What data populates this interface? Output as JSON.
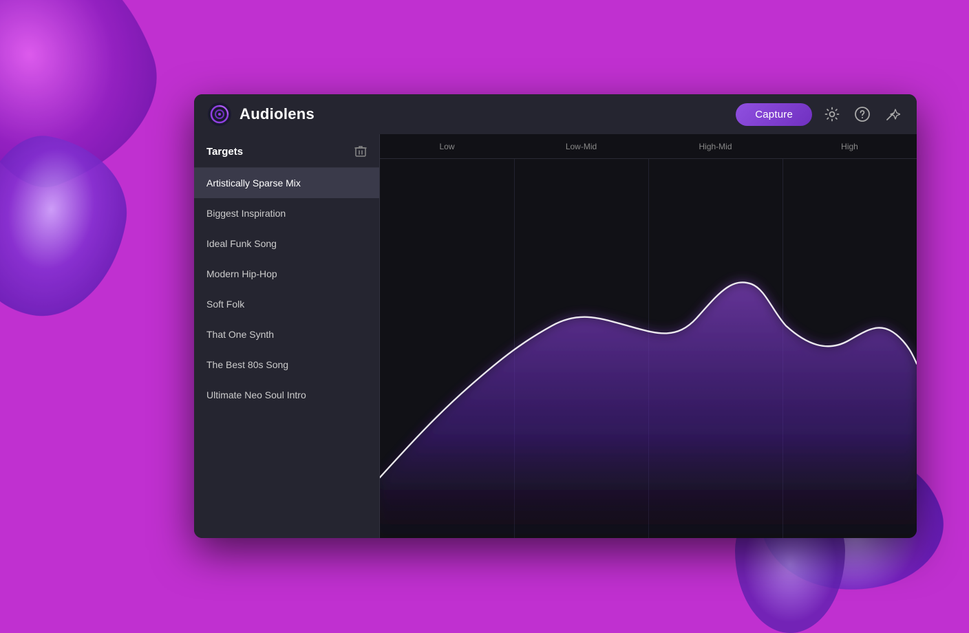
{
  "app": {
    "title": "Audiolens",
    "capture_label": "Capture"
  },
  "header": {
    "settings_icon": "⚙",
    "help_icon": "?",
    "wand_icon": "✦"
  },
  "sidebar": {
    "title": "Targets",
    "trash_icon": "🗑",
    "items": [
      {
        "label": "Artistically Sparse Mix",
        "active": true
      },
      {
        "label": "Biggest Inspiration",
        "active": false
      },
      {
        "label": "Ideal Funk Song",
        "active": false
      },
      {
        "label": "Modern Hip-Hop",
        "active": false
      },
      {
        "label": "Soft Folk",
        "active": false
      },
      {
        "label": "That One Synth",
        "active": false
      },
      {
        "label": "The Best 80s Song",
        "active": false
      },
      {
        "label": "Ultimate Neo Soul Intro",
        "active": false
      }
    ]
  },
  "spectrum": {
    "freq_labels": [
      "Low",
      "Low-Mid",
      "High-Mid",
      "High"
    ],
    "accent_color": "#8040d0"
  }
}
